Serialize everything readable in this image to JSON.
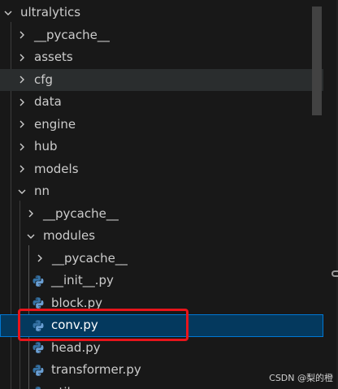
{
  "tree": {
    "items": [
      {
        "label": "ultralytics",
        "chevron": "down",
        "icon": "",
        "selected": false,
        "hover": false
      },
      {
        "label": "__pycache__",
        "chevron": "right",
        "icon": "",
        "selected": false,
        "hover": false
      },
      {
        "label": "assets",
        "chevron": "right",
        "icon": "",
        "selected": false,
        "hover": false
      },
      {
        "label": "cfg",
        "chevron": "right",
        "icon": "",
        "selected": false,
        "hover": true
      },
      {
        "label": "data",
        "chevron": "right",
        "icon": "",
        "selected": false,
        "hover": false
      },
      {
        "label": "engine",
        "chevron": "right",
        "icon": "",
        "selected": false,
        "hover": false
      },
      {
        "label": "hub",
        "chevron": "right",
        "icon": "",
        "selected": false,
        "hover": false
      },
      {
        "label": "models",
        "chevron": "right",
        "icon": "",
        "selected": false,
        "hover": false
      },
      {
        "label": "nn",
        "chevron": "down",
        "icon": "",
        "selected": false,
        "hover": false
      },
      {
        "label": "__pycache__",
        "chevron": "right",
        "icon": "",
        "selected": false,
        "hover": false
      },
      {
        "label": "modules",
        "chevron": "down",
        "icon": "",
        "selected": false,
        "hover": false
      },
      {
        "label": "__pycache__",
        "chevron": "right",
        "icon": "",
        "selected": false,
        "hover": false
      },
      {
        "label": "__init__.py",
        "chevron": "",
        "icon": "python-icon",
        "selected": false,
        "hover": false
      },
      {
        "label": "block.py",
        "chevron": "",
        "icon": "python-icon",
        "selected": false,
        "hover": false
      },
      {
        "label": "conv.py",
        "chevron": "",
        "icon": "python-icon",
        "selected": true,
        "hover": false
      },
      {
        "label": "head.py",
        "chevron": "",
        "icon": "python-icon",
        "selected": false,
        "hover": false
      },
      {
        "label": "transformer.py",
        "chevron": "",
        "icon": "python-icon",
        "selected": false,
        "hover": false
      },
      {
        "label": "utils.py",
        "chevron": "",
        "icon": "python-icon",
        "selected": false,
        "hover": false
      }
    ]
  },
  "watermark": "CSDN @梨的橙",
  "colors": {
    "background": "#181818",
    "hover": "#2a2d2e",
    "selected_bg": "#04395e",
    "selected_border": "#0078d4",
    "annotation": "#e8141b",
    "python_blue": "#3572a5",
    "python_yellow": "#f2cc3f"
  }
}
